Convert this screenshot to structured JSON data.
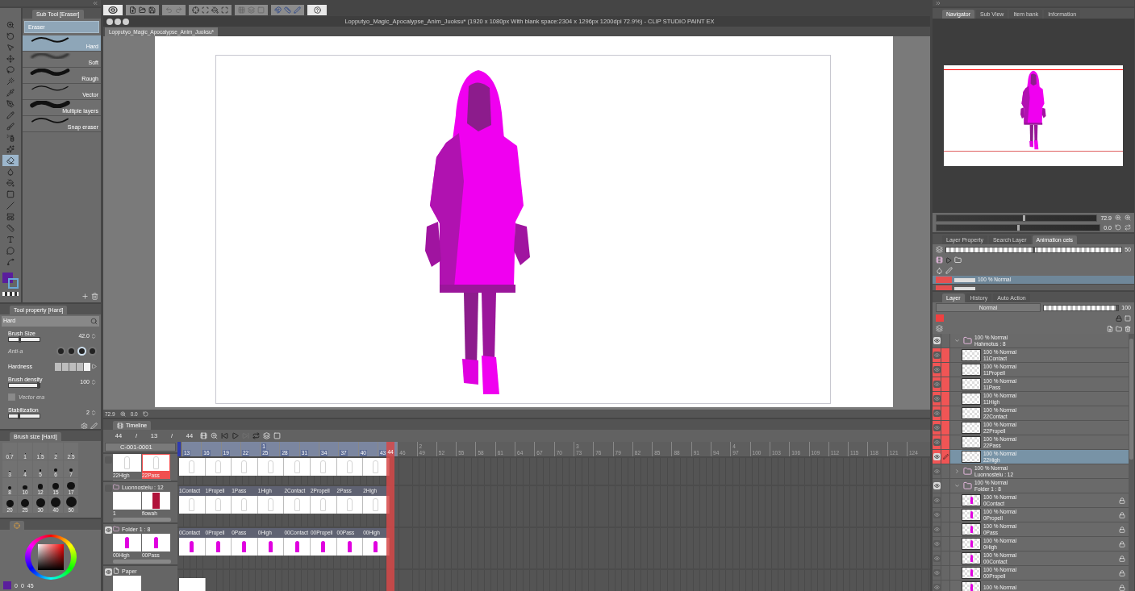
{
  "window": {
    "title": "Lopputyo_Magic_Apocalypse_Anim_Juoksu* (1920 x 1080px With blank space:2304 x 1296px 1200dpi 72.9%) - CLIP STUDIO PAINT EX"
  },
  "document_tab": {
    "label": "Lopputyo_Magic_Apocalypse_Anim_Juoksu*"
  },
  "tools": [
    {
      "kind": "zoom",
      "selected": false
    },
    {
      "kind": "rotate",
      "selected": false
    },
    {
      "kind": "operation",
      "selected": false
    },
    {
      "kind": "move",
      "selected": false
    },
    {
      "kind": "selection",
      "selected": false
    },
    {
      "kind": "auto-select",
      "selected": false
    },
    {
      "kind": "eyedropper",
      "selected": false
    },
    {
      "kind": "pen",
      "selected": false
    },
    {
      "kind": "pencil",
      "selected": false
    },
    {
      "kind": "brush",
      "selected": false
    },
    {
      "kind": "airbrush",
      "selected": false
    },
    {
      "kind": "decoration",
      "selected": false
    },
    {
      "kind": "eraser",
      "selected": true
    },
    {
      "kind": "blend",
      "selected": false
    },
    {
      "kind": "fill",
      "selected": false
    },
    {
      "kind": "gradient",
      "selected": false
    },
    {
      "kind": "figure",
      "selected": false
    },
    {
      "kind": "frame",
      "selected": false
    },
    {
      "kind": "ruler",
      "selected": false
    },
    {
      "kind": "text",
      "selected": false
    },
    {
      "kind": "balloon",
      "selected": false
    },
    {
      "kind": "correct",
      "selected": false
    }
  ],
  "color_swatches": [
    {
      "kind": "main",
      "color": "#5a1e9c"
    },
    {
      "kind": "sub",
      "color": "#6aa8d8"
    }
  ],
  "sub_tool": {
    "tab": "Sub Tool [Eraser]",
    "group": "Eraser",
    "items": [
      {
        "label": "Hard",
        "kind": "hard",
        "selected": true
      },
      {
        "label": "Soft",
        "kind": "soft",
        "selected": false
      },
      {
        "label": "Rough",
        "kind": "rough",
        "selected": false
      },
      {
        "label": "Vector",
        "kind": "vector",
        "selected": false
      },
      {
        "label": "Multiple layers",
        "kind": "multi",
        "selected": false
      },
      {
        "label": "Snap eraser",
        "kind": "snap",
        "selected": false
      }
    ]
  },
  "tool_property": {
    "tab": "Tool property [Hard]",
    "preview_label": "Hard",
    "rows": [
      {
        "kind": "slider",
        "label": "Brush Size",
        "value": "42.0",
        "level": 0.35
      },
      {
        "kind": "anti_alias",
        "label": "Anti-a",
        "options": [
          {
            "selected": false
          },
          {
            "selected": false
          },
          {
            "selected": true
          },
          {
            "selected": false
          }
        ]
      },
      {
        "kind": "hardness",
        "label": "Hardness",
        "steps": [
          {
            "selected": false
          },
          {
            "selected": false
          },
          {
            "selected": false
          },
          {
            "selected": false
          },
          {
            "selected": true
          }
        ]
      },
      {
        "kind": "slider",
        "label": "Brush density",
        "value": "100",
        "level": 1
      },
      {
        "kind": "checkbox",
        "label": "Vector era",
        "checked": true,
        "disabled": true
      },
      {
        "kind": "slider",
        "label": "Stabilization",
        "value": "2",
        "level": 0.3
      }
    ]
  },
  "brush_size": {
    "tab": "Brush size [Hard]",
    "sizes": [
      "0.7",
      "1",
      "1.5",
      "2",
      "2.5",
      "3",
      "4",
      "5",
      "6",
      "7",
      "8",
      "10",
      "12",
      "15",
      "17",
      "20",
      "25",
      "30",
      "40",
      "50"
    ]
  },
  "color_panel": {
    "values": [
      "0",
      "0",
      "45"
    ]
  },
  "canvas_status": {
    "zoom": "72.9",
    "rotation": "0.0"
  },
  "timeline": {
    "tab": "Timeline",
    "counters": [
      "44",
      "/",
      "13",
      "/",
      "44"
    ],
    "track_name": "C-001-0001",
    "ticks": [
      {
        "label": "13",
        "in_range": true
      },
      {
        "label": "16",
        "in_range": true
      },
      {
        "label": "19",
        "in_range": true
      },
      {
        "label": "22",
        "in_range": true
      },
      {
        "label": "25",
        "section": "1",
        "in_range": true
      },
      {
        "label": "28",
        "in_range": true
      },
      {
        "label": "31",
        "in_range": true
      },
      {
        "label": "34",
        "in_range": true
      },
      {
        "label": "37",
        "in_range": true
      },
      {
        "label": "40",
        "in_range": true
      },
      {
        "label": "43",
        "in_range": true
      },
      {
        "label": "44",
        "kind": "current",
        "in_range": true
      },
      {
        "label": "46",
        "in_range": false
      },
      {
        "label": "49",
        "section": "2",
        "in_range": false
      },
      {
        "label": "52",
        "in_range": false
      },
      {
        "label": "55",
        "in_range": false
      },
      {
        "label": "58",
        "in_range": false
      },
      {
        "label": "61",
        "in_range": false
      },
      {
        "label": "64",
        "in_range": false
      },
      {
        "label": "67",
        "in_range": false
      },
      {
        "label": "70",
        "in_range": false
      },
      {
        "label": "73",
        "section": "3",
        "in_range": false
      },
      {
        "label": "76",
        "in_range": false
      },
      {
        "label": "79",
        "in_range": false
      },
      {
        "label": "82",
        "in_range": false
      },
      {
        "label": "85",
        "in_range": false
      },
      {
        "label": "88",
        "in_range": false
      },
      {
        "label": "91",
        "in_range": false
      },
      {
        "label": "94",
        "in_range": false
      },
      {
        "label": "97",
        "section": "4",
        "in_range": false
      },
      {
        "label": "100",
        "in_range": false
      },
      {
        "label": "103",
        "in_range": false
      },
      {
        "label": "106",
        "in_range": false
      },
      {
        "label": "109",
        "in_range": false
      },
      {
        "label": "112",
        "in_range": false
      },
      {
        "label": "115",
        "in_range": false
      },
      {
        "label": "118",
        "in_range": false
      },
      {
        "label": "121",
        "in_range": false
      },
      {
        "label": "124",
        "in_range": false
      }
    ],
    "tracks": [
      {
        "kind": "cels",
        "visible": false,
        "thumbs": [
          {
            "label": "22High",
            "kind": "ghost",
            "selected": false
          },
          {
            "label": "22Pass",
            "kind": "ghost",
            "selected": true
          }
        ],
        "cells": [
          {
            "kind": "ghost"
          },
          {
            "kind": "ghost"
          },
          {
            "kind": "ghost"
          },
          {
            "kind": "ghost"
          },
          {
            "kind": "ghost"
          },
          {
            "kind": "ghost"
          },
          {
            "kind": "ghost"
          },
          {
            "kind": "ghost"
          }
        ]
      },
      {
        "kind": "folder",
        "name": "Luonnostelu : 12",
        "visible": false,
        "thumbs": [
          {
            "label": "1",
            "kind": "blank",
            "selected": false
          },
          {
            "label": "flowah",
            "kind": "dark",
            "selected": false
          }
        ],
        "cells": [
          {
            "label": "1Contact",
            "kind": "ghost"
          },
          {
            "label": "1Propell",
            "kind": "ghost"
          },
          {
            "label": "1Pass",
            "kind": "ghost"
          },
          {
            "label": "1High",
            "kind": "ghost"
          },
          {
            "label": "2Contact",
            "kind": "ghost"
          },
          {
            "label": "2Propell",
            "kind": "ghost"
          },
          {
            "label": "2Pass",
            "kind": "ghost"
          },
          {
            "label": "2High",
            "kind": "ghost"
          }
        ]
      },
      {
        "kind": "folder",
        "name": "Folder 1 : 8",
        "visible": true,
        "thumbs": [
          {
            "label": "00High",
            "kind": "figure",
            "selected": false
          },
          {
            "label": "00Pass",
            "kind": "figure",
            "selected": false
          }
        ],
        "cells": [
          {
            "label": "0Contact",
            "kind": "figure"
          },
          {
            "label": "0Propell",
            "kind": "figure"
          },
          {
            "label": "0Pass",
            "kind": "figure"
          },
          {
            "label": "0High",
            "kind": "figure"
          },
          {
            "label": "00Contact",
            "kind": "figure"
          },
          {
            "label": "00Propell",
            "kind": "figure"
          },
          {
            "label": "00Pass",
            "kind": "figure"
          },
          {
            "label": "00High",
            "kind": "figure"
          }
        ]
      },
      {
        "kind": "paper",
        "name": "Paper",
        "visible": true,
        "thumbs": [
          {
            "kind": "blank",
            "selected": false
          }
        ],
        "cells": [
          {
            "kind": "blank"
          }
        ]
      }
    ]
  },
  "navigator": {
    "tabs": [
      {
        "label": "Navigator",
        "selected": true
      },
      {
        "label": "Sub View",
        "selected": false
      },
      {
        "label": "Item bank",
        "selected": false
      },
      {
        "label": "Information",
        "selected": false
      }
    ],
    "zoom": "72.9",
    "rotation": "0.0",
    "zoom_slider": {
      "level": 0.55
    },
    "rotation_slider": {
      "level": 0.5
    }
  },
  "animation_cels": {
    "tabs": [
      {
        "label": "Layer Property",
        "selected": false
      },
      {
        "label": "Search Layer",
        "selected": false
      },
      {
        "label": "Animation cels",
        "selected": true
      }
    ],
    "opacity": "50",
    "opacity_slider": {
      "level": 0.5
    },
    "cels": [
      {
        "label": "100 % Normal",
        "selected": true
      },
      {
        "selected": false
      }
    ]
  },
  "layer_panel": {
    "tabs": [
      {
        "label": "Layer",
        "selected": true
      },
      {
        "label": "History",
        "selected": false
      },
      {
        "label": "Auto Action",
        "selected": false
      }
    ],
    "blend_mode": "Normal",
    "opacity": "100",
    "opacity_slider": {
      "level": 1
    },
    "layers": [
      {
        "kind": "folder",
        "blend": "100 % Normal",
        "name": "Hahmotus : 8",
        "visible": true,
        "marked": false,
        "selected": false,
        "expanded": true,
        "children": [
          {
            "kind": "blank",
            "blend": "100 % Normal",
            "name": "11Contact",
            "visible": false,
            "marked": true,
            "selected": false,
            "locked": false
          },
          {
            "kind": "blank",
            "blend": "100 % Normal",
            "name": "11Propell",
            "visible": false,
            "marked": true,
            "selected": false,
            "locked": false
          },
          {
            "kind": "blank",
            "blend": "100 % Normal",
            "name": "11Pass",
            "visible": false,
            "marked": true,
            "selected": false,
            "locked": false
          },
          {
            "kind": "blank",
            "blend": "100 % Normal",
            "name": "11High",
            "visible": false,
            "marked": true,
            "selected": false,
            "locked": false
          },
          {
            "kind": "blank",
            "blend": "100 % Normal",
            "name": "22Contact",
            "visible": false,
            "marked": true,
            "selected": false,
            "locked": false
          },
          {
            "kind": "blank",
            "blend": "100 % Normal",
            "name": "22Propell",
            "visible": false,
            "marked": true,
            "selected": false,
            "locked": false
          },
          {
            "kind": "blank",
            "blend": "100 % Normal",
            "name": "22Pass",
            "visible": false,
            "marked": true,
            "selected": false,
            "locked": false
          },
          {
            "kind": "blank",
            "blend": "100 % Normal",
            "name": "22High",
            "visible": true,
            "marked": true,
            "selected": true,
            "locked": false
          }
        ]
      },
      {
        "kind": "folder",
        "blend": "100 % Normal",
        "name": "Luonnostelu : 12",
        "visible": false,
        "marked": false,
        "selected": false,
        "expanded": false
      },
      {
        "kind": "folder",
        "blend": "100 % Normal",
        "name": "Folder 1 : 8",
        "visible": true,
        "marked": false,
        "selected": false,
        "expanded": true,
        "children": [
          {
            "kind": "figure",
            "blend": "100 % Normal",
            "name": "0Contact",
            "visible": false,
            "marked": false,
            "selected": false,
            "locked": true
          },
          {
            "kind": "figure",
            "blend": "100 % Normal",
            "name": "0Propell",
            "visible": false,
            "marked": false,
            "selected": false,
            "locked": true
          },
          {
            "kind": "figure",
            "blend": "100 % Normal",
            "name": "0Pass",
            "visible": false,
            "marked": false,
            "selected": false,
            "locked": true
          },
          {
            "kind": "figure",
            "blend": "100 % Normal",
            "name": "0High",
            "visible": false,
            "marked": false,
            "selected": false,
            "locked": true
          },
          {
            "kind": "figure",
            "blend": "100 % Normal",
            "name": "00Contact",
            "visible": false,
            "marked": false,
            "selected": false,
            "locked": true
          },
          {
            "kind": "figure",
            "blend": "100 % Normal",
            "name": "00Propell",
            "visible": false,
            "marked": false,
            "selected": false,
            "locked": true
          },
          {
            "kind": "figure",
            "blend": "100 % Normal",
            "visible": false,
            "marked": false,
            "selected": false,
            "locked": true
          }
        ]
      }
    ]
  }
}
